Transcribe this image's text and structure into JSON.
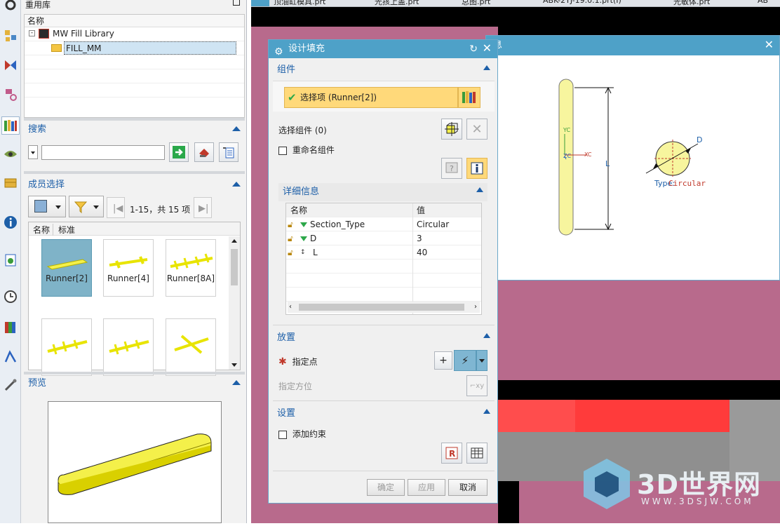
{
  "library": {
    "title": "重用库",
    "tree_header": "名称",
    "tree_items": [
      "MW Fill Library",
      "FILL_MM"
    ],
    "search_label": "搜索",
    "member_label": "成员选择",
    "range_text": "1-15，共 15 项",
    "tab_name": "名称",
    "tab_standard": "标准",
    "thumbnails": [
      "Runner[2]",
      "Runner[4]",
      "Runner[8A]",
      "",
      "",
      ""
    ],
    "preview_label": "预览"
  },
  "tabs": [
    "顶油缸模具.prt",
    "光孩上盖.prt",
    "总图.prt",
    "ABK-2YJ-19.0.1.prt(I)",
    "光敏体.prt",
    "AB"
  ],
  "info_window": {
    "title_fragment": "息",
    "diagram": {
      "yc": "YC",
      "xc": "XC",
      "zc": "ZC",
      "l": "L",
      "d": "D",
      "type_label": "Type:",
      "type_value": "Circular"
    }
  },
  "dialog": {
    "title": "设计填充",
    "group_component": "组件",
    "select_item": "选择项 (Runner[2])",
    "select_component": "选择组件 (0)",
    "rename_component": "重命名组件",
    "details_label": "详细信息",
    "columns": [
      "名称",
      "值"
    ],
    "rows": [
      {
        "name": "Section_Type",
        "value": "Circular"
      },
      {
        "name": "D",
        "value": "3"
      },
      {
        "name": "L",
        "value": "40"
      }
    ],
    "group_placement": "放置",
    "specify_point": "指定点",
    "specify_orientation": "指定方位",
    "group_settings": "设置",
    "add_constraint": "添加约束",
    "ok": "确定",
    "apply": "应用",
    "cancel": "取消"
  },
  "watermark": {
    "brand": "3D世界网",
    "url": "WWW.3DSJW.COM"
  },
  "colors": {
    "title_bar": "#4ea1c8",
    "highlight": "#ffd97a",
    "canvas": "#b86a8c",
    "runner_yellow": "#f4f04a"
  }
}
